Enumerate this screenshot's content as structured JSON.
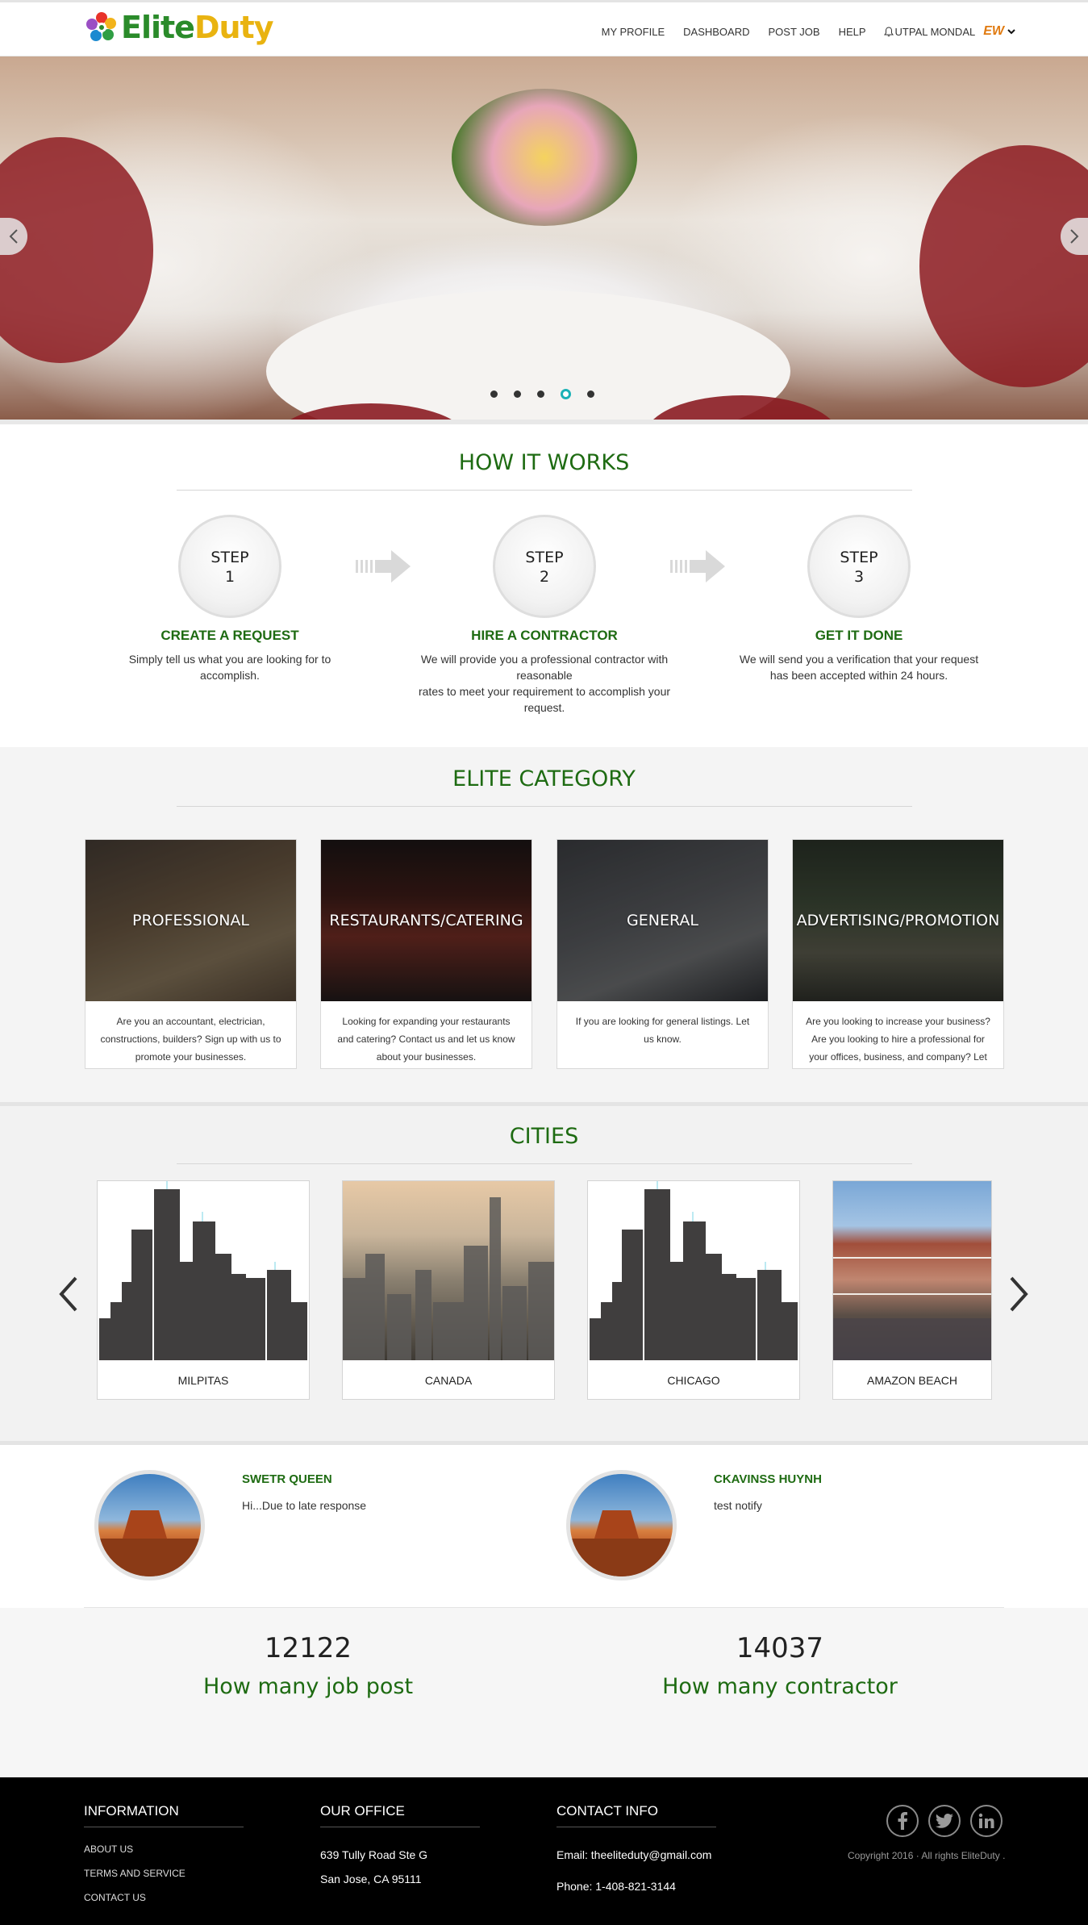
{
  "brand": {
    "name_part1": "Elite",
    "name_part2": "Duty",
    "mini_logo": "EW"
  },
  "nav": {
    "items": [
      "MY PROFILE",
      "DASHBOARD",
      "POST JOB",
      "HELP"
    ],
    "user": "UTPAL MONDAL",
    "icons": [
      "bell-icon",
      "chevron-down-icon"
    ]
  },
  "hero": {
    "active_slide": 4,
    "slide_count": 5
  },
  "how_it_works": {
    "title": "HOW IT WORKS",
    "steps": [
      {
        "label": "STEP",
        "num": "1",
        "title": "CREATE A REQUEST",
        "desc": "Simply tell us what you are looking for to accomplish."
      },
      {
        "label": "STEP",
        "num": "2",
        "title": "HIRE A CONTRACTOR",
        "desc": "We will provide you a professional contractor with reasonable\nrates to meet your requirement to accomplish your request."
      },
      {
        "label": "STEP",
        "num": "3",
        "title": "GET IT DONE",
        "desc": "We will send you a verification that your request has been accepted within 24 hours."
      }
    ]
  },
  "categories": {
    "title": "ELITE CATEGORY",
    "items": [
      {
        "name": "PROFESSIONAL",
        "desc": "Are you an accountant, electrician, constructions, builders? Sign up with us to promote your businesses."
      },
      {
        "name": "RESTAURANTS/CATERING",
        "desc": "Looking for expanding your restaurants and catering? Contact us and let us know about your businesses."
      },
      {
        "name": "GENERAL",
        "desc": "If you are looking for general listings. Let us know."
      },
      {
        "name": "ADVERTISING/PROMOTION",
        "desc": "Are you looking to increase your business? Are you looking to hire a professional for your offices, business, and company? Let"
      }
    ]
  },
  "cities": {
    "title": "CITIES",
    "items": [
      "MILPITAS",
      "CANADA",
      "CHICAGO",
      "AMAZON BEACH"
    ]
  },
  "testimonials": [
    {
      "name": "SWETR QUEEN",
      "text": "Hi...Due to late response"
    },
    {
      "name": "CKAVINSS HUYNH",
      "text": "test notify"
    }
  ],
  "stats": [
    {
      "value": "12122",
      "label": "How many job post"
    },
    {
      "value": "14037",
      "label": "How many contractor"
    }
  ],
  "footer": {
    "information": {
      "title": "INFORMATION",
      "links": [
        "ABOUT US",
        "TERMS AND SERVICE",
        "CONTACT US"
      ]
    },
    "office": {
      "title": "OUR OFFICE",
      "line1": "639 Tully Road Ste G",
      "line2": "San Jose, CA 95111"
    },
    "contact": {
      "title": "CONTACT INFO",
      "email": "Email: theeliteduty@gmail.com",
      "phone": "Phone: 1-408-821-3144"
    },
    "social": [
      "facebook-icon",
      "twitter-icon",
      "linkedin-icon"
    ],
    "copyright": "Copyright 2016 · All rights EliteDuty ."
  },
  "colors": {
    "accent_green": "#1e6b12",
    "logo_green": "#2a8b2a",
    "logo_yellow": "#e9b310",
    "slider_dot_active": "#1ab1b6"
  }
}
